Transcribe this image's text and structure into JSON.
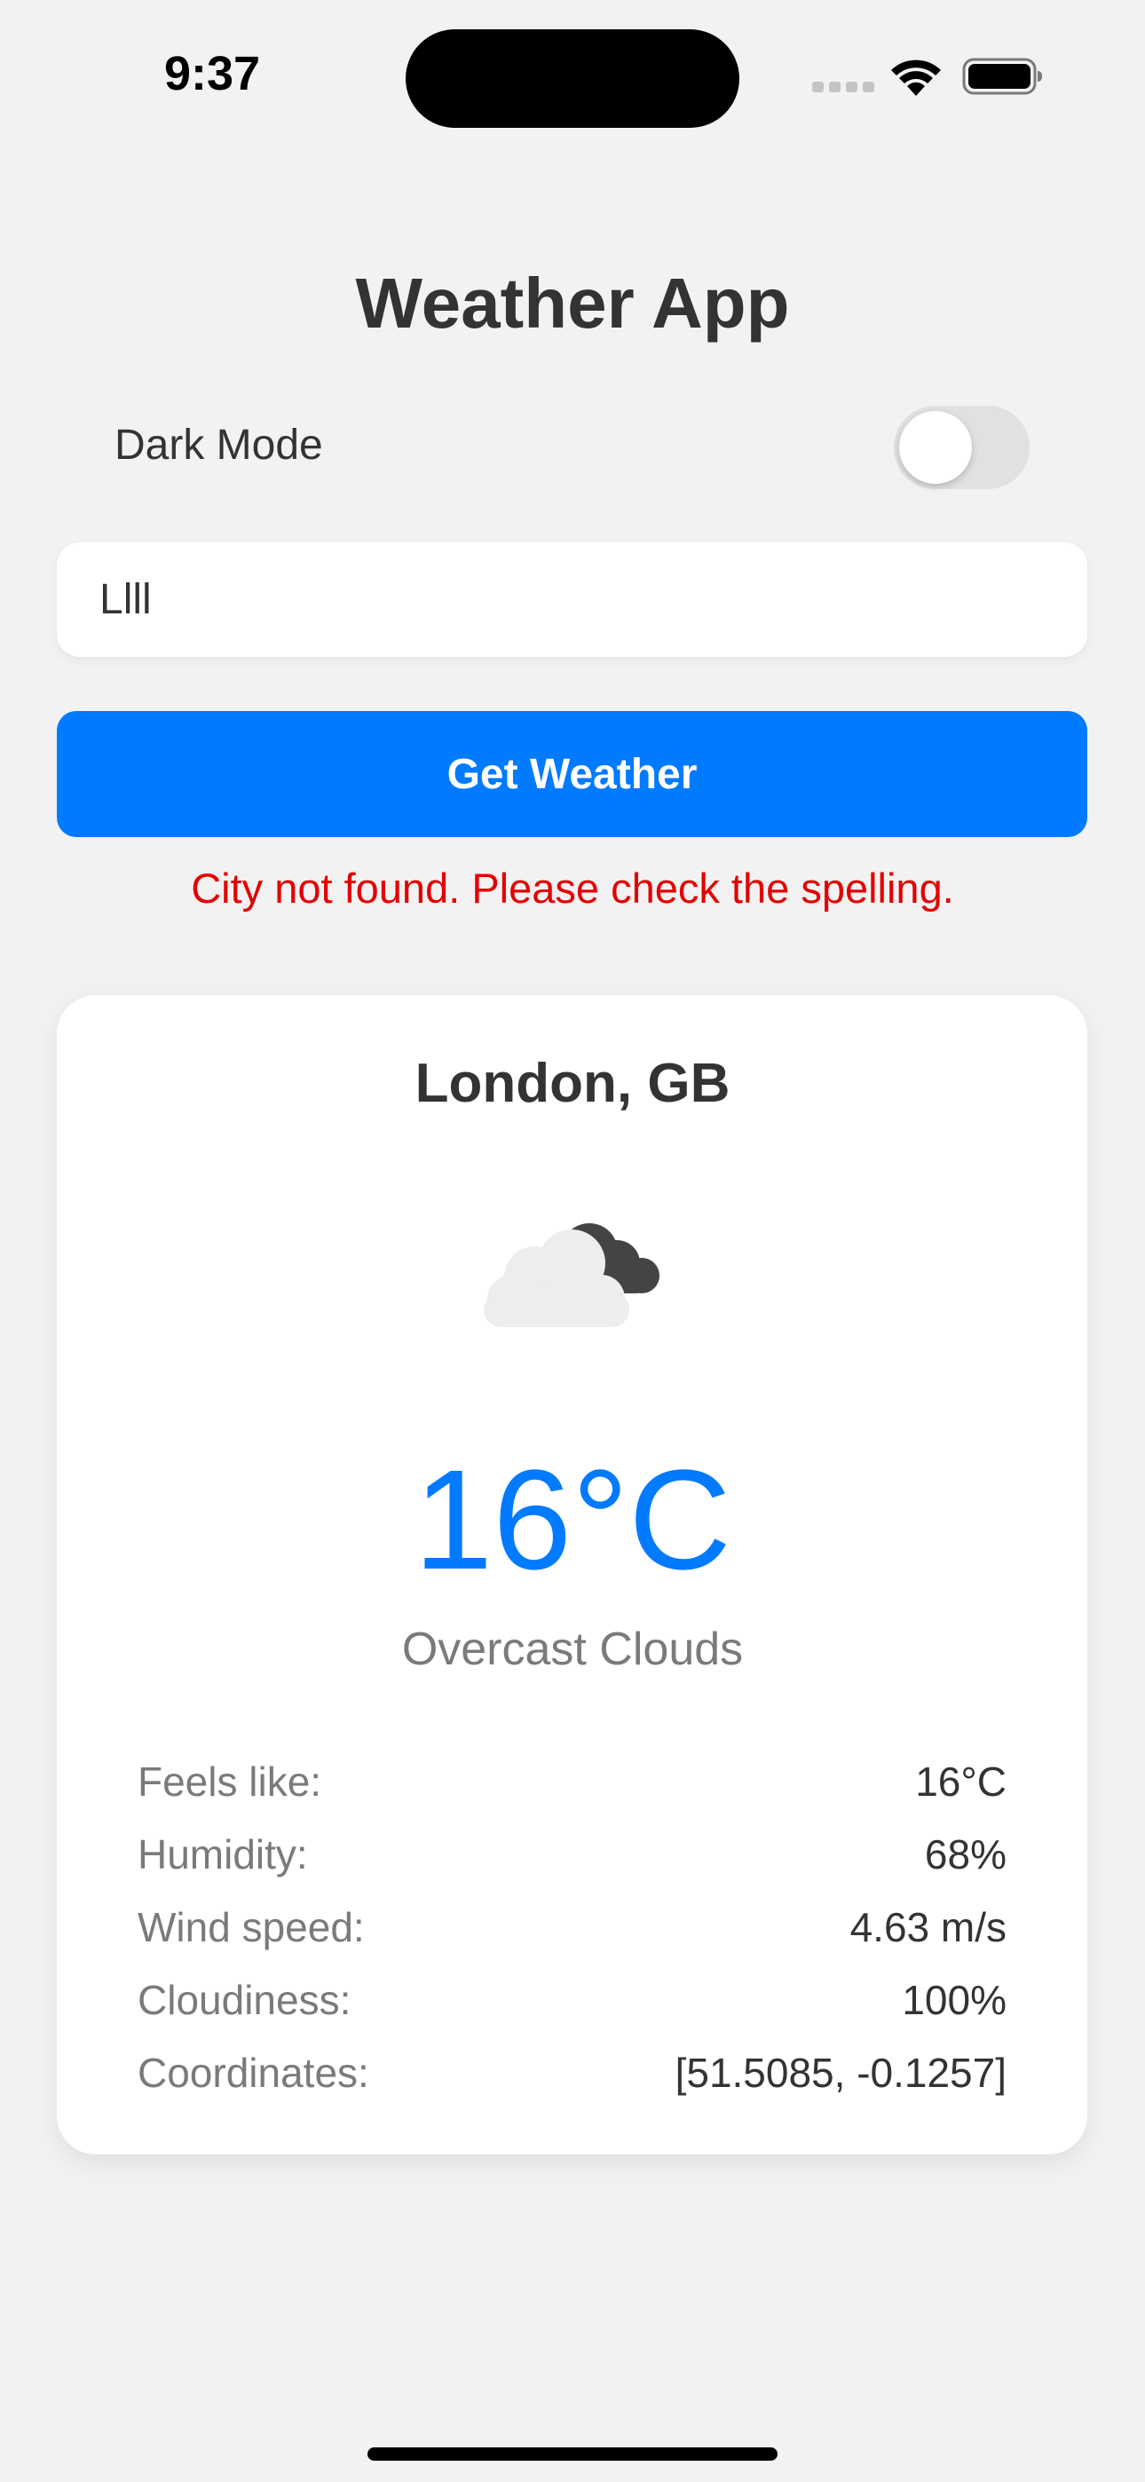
{
  "status_bar": {
    "time": "9:37",
    "icons": [
      "signal-dots-icon",
      "wifi-icon",
      "battery-icon"
    ]
  },
  "app": {
    "title": "Weather App",
    "dark_mode_label": "Dark Mode",
    "dark_mode_enabled": false,
    "city_input_value": "Llll",
    "button_label": "Get Weather",
    "error_message": "City not found. Please check the spelling."
  },
  "weather": {
    "city": "London, GB",
    "icon": "overcast-clouds-icon",
    "temperature": "16°C",
    "description": "Overcast Clouds",
    "details": [
      {
        "label": "Feels like:",
        "value": "16°C"
      },
      {
        "label": "Humidity:",
        "value": "68%"
      },
      {
        "label": "Wind speed:",
        "value": "4.63 m/s"
      },
      {
        "label": "Cloudiness:",
        "value": "100%"
      },
      {
        "label": "Coordinates:",
        "value": "[51.5085, -0.1257]"
      }
    ]
  },
  "colors": {
    "accent": "#007aff",
    "error": "#e30000",
    "background": "#f2f2f2",
    "card": "#ffffff"
  }
}
